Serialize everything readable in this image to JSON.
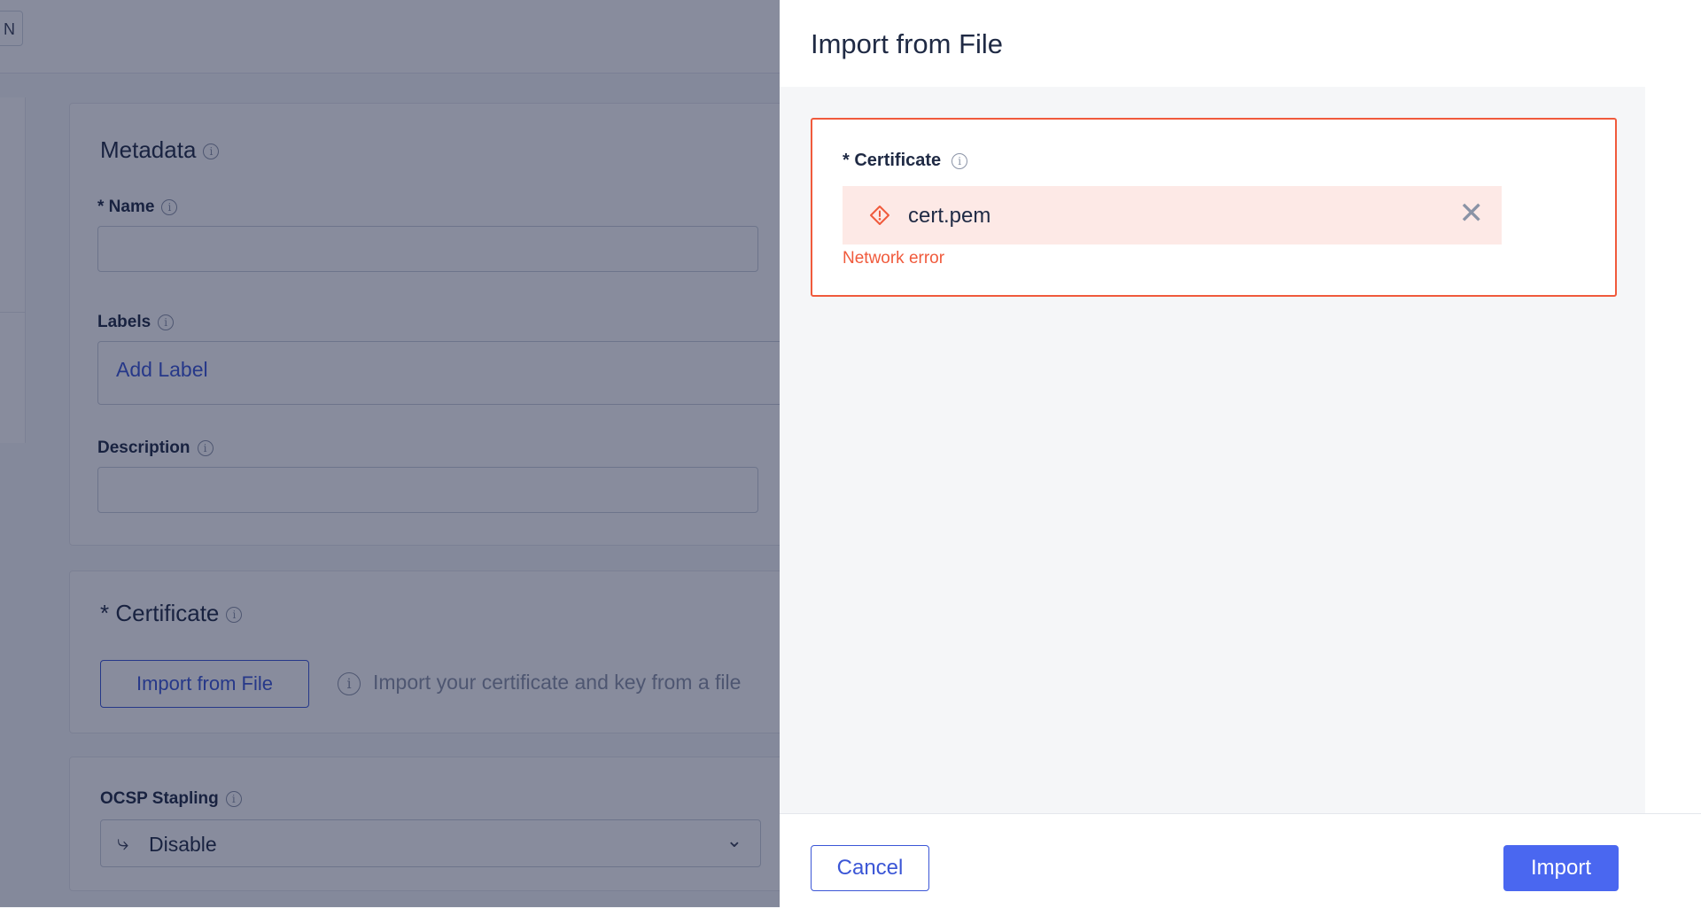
{
  "background": {
    "topbar_button_label": "N",
    "metadata": {
      "title": "Metadata",
      "name_label": "* Name",
      "labels_label": "Labels",
      "labels_placeholder": "Add Label",
      "description_label": "Description"
    },
    "certificate": {
      "title": "* Certificate",
      "import_button": "Import from File",
      "hint": "Import your certificate and key from a file"
    },
    "ocsp": {
      "label": "OCSP Stapling",
      "selected": "Disable"
    }
  },
  "drawer": {
    "title": "Import from File",
    "certificate_label": "* Certificate",
    "file_name": "cert.pem",
    "error": "Network error",
    "cancel_label": "Cancel",
    "import_label": "Import"
  },
  "icons": {
    "info": "info-icon",
    "warning": "warning-diamond-icon",
    "close": "close-icon",
    "select_chevron": "chevron-down-icon",
    "stapling": "branch-icon"
  },
  "colors": {
    "accent": "#4a67f0",
    "error": "#f05a3c",
    "error_bg": "#fde9e6",
    "overlay": "rgba(18,26,60,0.5)"
  }
}
